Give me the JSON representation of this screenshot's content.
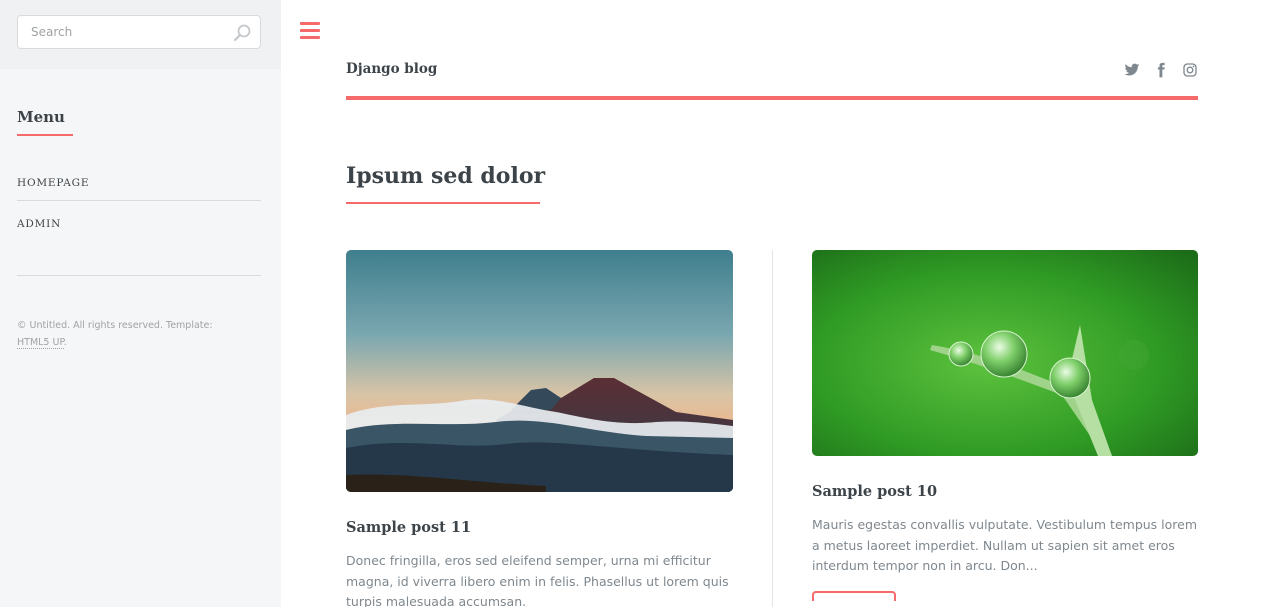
{
  "sidebar": {
    "search": {
      "placeholder": "Search",
      "value": ""
    },
    "menu": {
      "title": "Menu",
      "items": [
        {
          "label": "HOMEPAGE"
        },
        {
          "label": "ADMIN"
        }
      ]
    },
    "footer": {
      "text": "© Untitled. All rights reserved. Template:",
      "link": "HTML5 UP",
      "end": "."
    }
  },
  "header": {
    "logo": "Django blog",
    "social": [
      "twitter-icon",
      "facebook-icon",
      "instagram-icon"
    ]
  },
  "section": {
    "title": "Ipsum sed dolor"
  },
  "posts": [
    {
      "title": "Sample post 11",
      "excerpt": "Donec fringilla, eros sed eleifend semper, urna mi efficitur magna, id viverra libero enim in felis. Phasellus ut lorem quis turpis malesuada accumsan.",
      "image": "mountain-landscape"
    },
    {
      "title": "Sample post 10",
      "excerpt": "Mauris egestas convallis vulputate. Vestibulum tempus lorem a metus laoreet imperdiet. Nullam ut sapien sit amet eros interdum tempor non in arcu. Don...",
      "image": "water-droplets-grass"
    }
  ],
  "colors": {
    "accent": "#f56a6a",
    "heading": "#3d4449",
    "text": "#7f888f",
    "sidebar_bg": "#f5f6f7"
  }
}
